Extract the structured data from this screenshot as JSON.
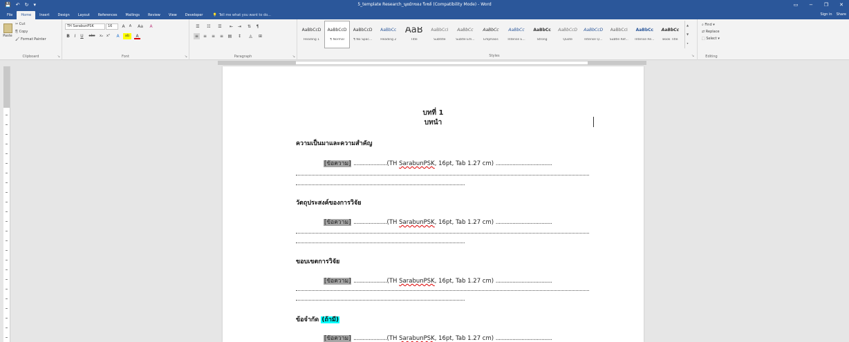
{
  "window": {
    "title": "5_template Research_นุยมักของ รีเซล์ (Compatibility Mode) - Word",
    "controls": [
      "▭",
      "−",
      "❐",
      "✕"
    ]
  },
  "qat": {
    "save": "💾",
    "undo": "↶",
    "redo": "↻",
    "more": "▾"
  },
  "tabs": [
    "File",
    "Home",
    "Insert",
    "Design",
    "Layout",
    "References",
    "Mailings",
    "Review",
    "View",
    "Developer"
  ],
  "tell_me": {
    "icon": "💡",
    "placeholder": "Tell me what you want to do..."
  },
  "account": {
    "sign_in": "Sign in",
    "share": "Share"
  },
  "ribbon": {
    "clipboard": {
      "label": "Clipboard",
      "paste": "Paste",
      "cut": "Cut",
      "copy": "Copy",
      "format_painter": "Format Painter"
    },
    "font": {
      "label": "Font",
      "font_name": "TH SarabunPSK",
      "font_size": "16",
      "grow": "A",
      "shrink": "A",
      "case": "Aa",
      "clear": "A",
      "bold": "B",
      "italic": "I",
      "underline": "U",
      "strike": "abc",
      "sub": "x₂",
      "sup": "x²",
      "effects": "A",
      "highlight": "ab",
      "color": "A"
    },
    "paragraph": {
      "label": "Paragraph"
    },
    "styles": {
      "label": "Styles",
      "items": [
        {
          "preview": "AaBbCcD",
          "name": "Heading 1"
        },
        {
          "preview": "AaBbCcD",
          "name": "¶ Normal"
        },
        {
          "preview": "AaBbCcD",
          "name": "¶ No Spac..."
        },
        {
          "preview": "AaBbCc",
          "name": "Heading 2"
        },
        {
          "preview": "AaB",
          "name": "Title"
        },
        {
          "preview": "AaBbCcI",
          "name": "Subtitle"
        },
        {
          "preview": "AaBbCc",
          "name": "Subtle Em..."
        },
        {
          "preview": "AaBbCc",
          "name": "Emphasis"
        },
        {
          "preview": "AaBbCc",
          "name": "Intense E..."
        },
        {
          "preview": "AaBbCc",
          "name": "Strong"
        },
        {
          "preview": "AaBbCcD",
          "name": "Quote"
        },
        {
          "preview": "AaBbCcD",
          "name": "Intense Q..."
        },
        {
          "preview": "AaBbCcI",
          "name": "Subtle Ref..."
        },
        {
          "preview": "AaBbCc",
          "name": "Intense Re..."
        },
        {
          "preview": "AaBbCc",
          "name": "Book Title"
        }
      ]
    },
    "editing": {
      "label": "Editing",
      "find": "Find",
      "replace": "Replace",
      "select": "Select"
    }
  },
  "document": {
    "chapter_title": "บทที่ 1",
    "chapter_sub": "บทนำ",
    "sections": [
      {
        "heading": "ความเป็นมาและความสำคัญ",
        "tag": "",
        "placeholder": "[ข้อความ]",
        "dots": "......................",
        "font_spec_prefix": "(TH ",
        "font_spec_name": "SarabunPSK",
        "font_spec_suffix": ", 16pt, Tab 1.27 cm)",
        "trail": "....................................."
      },
      {
        "heading": "วัตถุประสงค์ของการวิจัย",
        "tag": "",
        "placeholder": "[ข้อความ]",
        "dots": "......................",
        "font_spec_prefix": "(TH ",
        "font_spec_name": "SarabunPSK",
        "font_spec_suffix": ", 16pt, Tab 1.27 cm)",
        "trail": "....................................."
      },
      {
        "heading": "ขอบเขตการวิจัย",
        "tag": "",
        "placeholder": "[ข้อความ]",
        "dots": "......................",
        "font_spec_prefix": "(TH ",
        "font_spec_name": "SarabunPSK",
        "font_spec_suffix": ", 16pt, Tab 1.27 cm)",
        "trail": "....................................."
      },
      {
        "heading": "ข้อจำกัด",
        "tag": "(ถ้ามี)",
        "placeholder": "[ข้อความ]",
        "dots": "......................",
        "font_spec_prefix": "(TH ",
        "font_spec_name": "SarabunPSK",
        "font_spec_suffix": ", 16pt, Tab 1.27 cm)",
        "trail": "....................................."
      }
    ]
  },
  "colors": {
    "accent": "#2b579a",
    "highlight_cyan": "#00ffff",
    "placeholder_gray": "#a6a6a6"
  }
}
